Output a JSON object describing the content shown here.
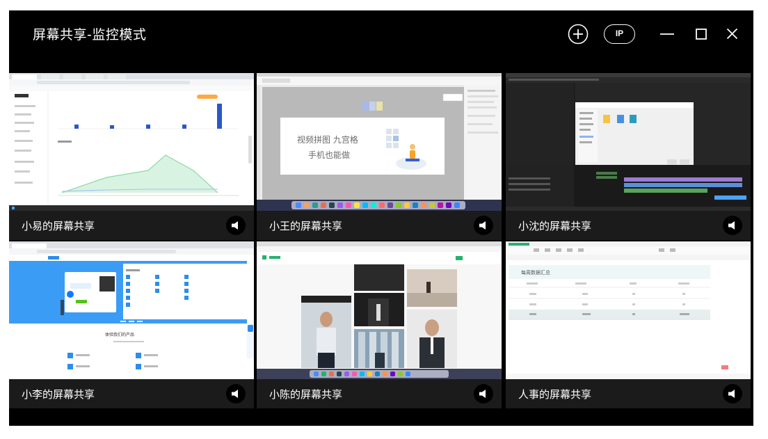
{
  "window": {
    "title": "屏幕共享-监控模式",
    "controls": {
      "add_icon": "plus-circle-icon",
      "ip_label": "IP",
      "minimize_icon": "minimize-icon",
      "maximize_icon": "maximize-icon",
      "close_icon": "close-icon"
    }
  },
  "tiles": [
    {
      "label": "小易的屏幕共享",
      "audio_icon": "speaker-icon"
    },
    {
      "label": "小王的屏幕共享",
      "audio_icon": "speaker-icon",
      "slide": {
        "line1": "视频拼图 九宫格",
        "line2": "手机也能做"
      }
    },
    {
      "label": "小沈的屏幕共享",
      "audio_icon": "speaker-icon"
    },
    {
      "label": "小李的屏幕共享",
      "audio_icon": "speaker-icon",
      "page": {
        "heading": "体验我们的产品"
      }
    },
    {
      "label": "小陈的屏幕共享",
      "audio_icon": "speaker-icon"
    },
    {
      "label": "人事的屏幕共享",
      "audio_icon": "speaker-icon",
      "sheet": {
        "heading": "每周数据汇总"
      }
    }
  ],
  "colors": {
    "window_bg": "#000000",
    "caption_bg": "#1b1b1b",
    "text": "#ffffff",
    "chart_blue": "#2a57c9",
    "chart_green": "#8fd9a8",
    "brand_blue": "#2d8cf0",
    "brand_green": "#23b26d"
  }
}
